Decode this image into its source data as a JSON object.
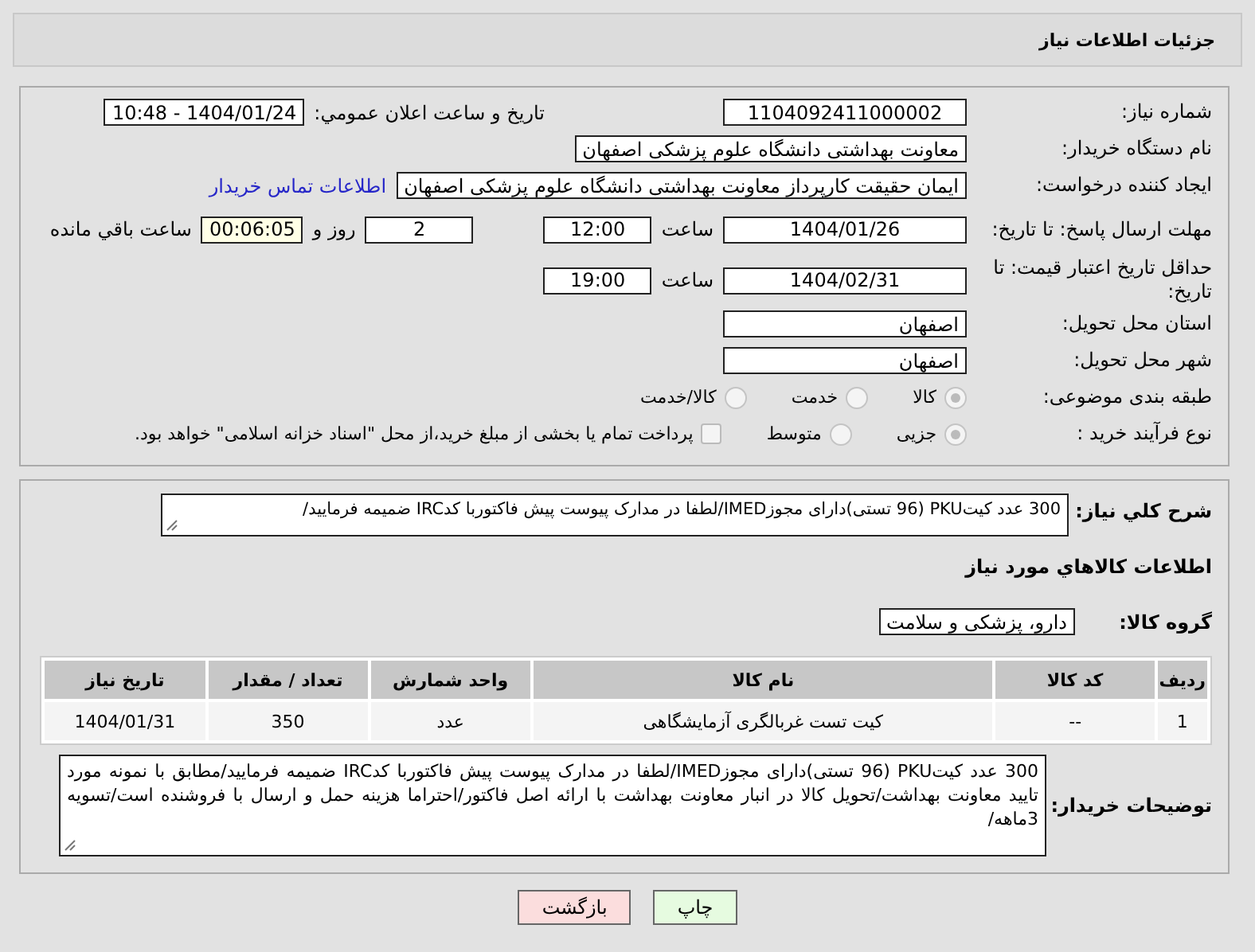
{
  "title": "جزئیات اطلاعات نیاز",
  "need_number": {
    "label": "شماره نیاز:",
    "value": "1104092411000002"
  },
  "announce": {
    "label": "تاریخ و ساعت اعلان عمومي:",
    "value": "1404/01/24 - 10:48"
  },
  "buyer": {
    "label": "نام دستگاه خریدار:",
    "value": "معاونت بهداشتی دانشگاه علوم پزشکی اصفهان"
  },
  "requester": {
    "label": "ایجاد کننده درخواست:",
    "value": "ایمان حقیقت کارپرداز معاونت بهداشتی دانشگاه علوم پزشکی اصفهان",
    "link": "اطلاعات تماس خریدار"
  },
  "deadline": {
    "label": "مهلت ارسال پاسخ: تا تاریخ:",
    "date": "1404/01/26",
    "time_label": "ساعت",
    "time": "12:00",
    "days": "2",
    "days_label": "روز و",
    "remaining": "00:06:05",
    "remaining_label": "ساعت باقي مانده"
  },
  "validity": {
    "label": "حداقل تاریخ اعتبار قیمت: تا تاریخ:",
    "date": "1404/02/31",
    "time_label": "ساعت",
    "time": "19:00"
  },
  "province": {
    "label": "استان محل تحویل:",
    "value": "اصفهان"
  },
  "city": {
    "label": "شهر محل تحویل:",
    "value": "اصفهان"
  },
  "category": {
    "label": "طبقه بندی موضوعی:",
    "options": [
      {
        "label": "کالا",
        "selected": true
      },
      {
        "label": "خدمت",
        "selected": false
      },
      {
        "label": "کالا/خدمت",
        "selected": false
      }
    ]
  },
  "process": {
    "label": "نوع فرآیند خرید :",
    "options": [
      {
        "label": "جزیی",
        "selected": true
      },
      {
        "label": "متوسط",
        "selected": false
      }
    ],
    "payment": {
      "checked": false,
      "text": "پرداخت تمام یا بخشی از مبلغ خرید،از محل \"اسناد خزانه اسلامی\" خواهد بود."
    }
  },
  "description": {
    "label": "شرح کلي نیاز:",
    "value": "300 عدد کیتPKU (96 تستی)دارای مجوزIMED/لطفا در مدارک پیوست پیش فاکتوربا کدIRC ضمیمه فرمایید/"
  },
  "items_heading": "اطلاعات کالاهاي مورد نیاز",
  "group": {
    "label": "گروه کالا:",
    "value": "دارو، پزشکی و سلامت"
  },
  "table": {
    "columns": [
      "ردیف",
      "کد کالا",
      "نام کالا",
      "واحد شمارش",
      "تعداد / مقدار",
      "تاریخ نیاز"
    ],
    "rows": [
      [
        "1",
        "--",
        "کیت تست غربالگری آزمایشگاهی",
        "عدد",
        "350",
        "1404/01/31"
      ]
    ]
  },
  "notes": {
    "label": "توضیحات خریدار:",
    "value": "300 عدد کیتPKU (96 تستی)دارای مجوزIMED/لطفا در مدارک پیوست پیش فاکتوربا کدIRC ضمیمه فرمایید/مطابق با نمونه مورد تایید معاونت بهداشت/تحویل کالا در انبار معاونت بهداشت با ارائه اصل فاکتور/احتراما هزینه حمل و ارسال با فروشنده است/تسویه 3ماهه/"
  },
  "buttons": [
    {
      "kind": "print",
      "label": "چاپ"
    },
    {
      "kind": "back",
      "label": "بازگشت"
    }
  ]
}
